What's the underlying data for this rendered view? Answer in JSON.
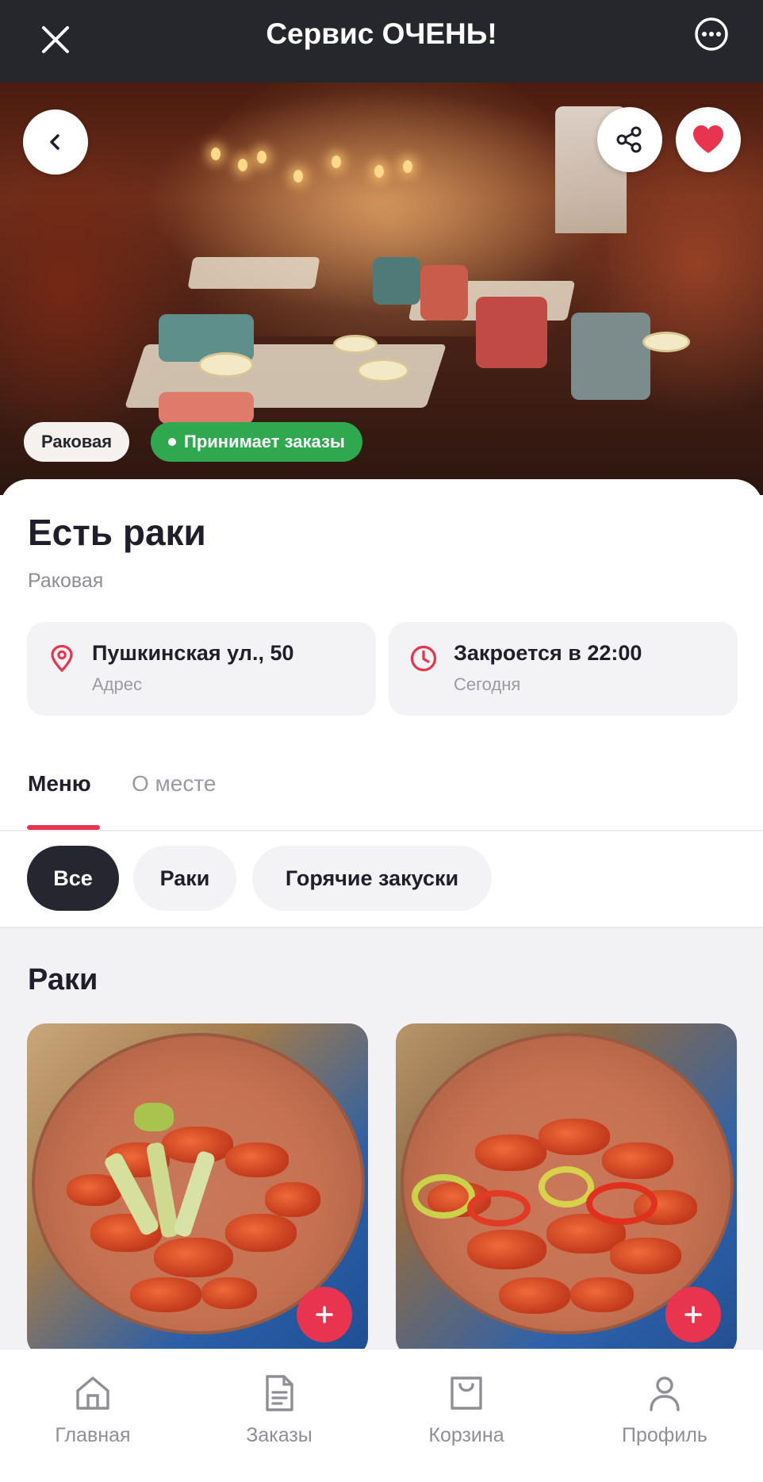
{
  "app_bar": {
    "title": "Сервис ОЧЕНЬ!",
    "close_icon": "close-icon",
    "more_icon": "more-icon"
  },
  "hero": {
    "category_tag": "Раковая",
    "status_tag": "Принимает заказы",
    "status_color": "#2fa84f",
    "favorite_color": "#e8344e"
  },
  "place": {
    "name": "Есть раки",
    "category": "Раковая",
    "address": {
      "value": "Пушкинская ул., 50",
      "label": "Адрес"
    },
    "hours": {
      "value": "Закроется в 22:00",
      "label": "Сегодня"
    }
  },
  "tabs": [
    {
      "label": "Меню",
      "active": true
    },
    {
      "label": "О месте",
      "active": false
    }
  ],
  "filters": [
    "Все",
    "Раки",
    "Горячие закуски"
  ],
  "section": {
    "title": "Раки"
  },
  "bottom_nav": [
    {
      "label": "Главная",
      "icon": "home-icon"
    },
    {
      "label": "Заказы",
      "icon": "orders-icon"
    },
    {
      "label": "Корзина",
      "icon": "cart-icon"
    },
    {
      "label": "Профиль",
      "icon": "profile-icon"
    }
  ],
  "accent_color": "#e8344e"
}
